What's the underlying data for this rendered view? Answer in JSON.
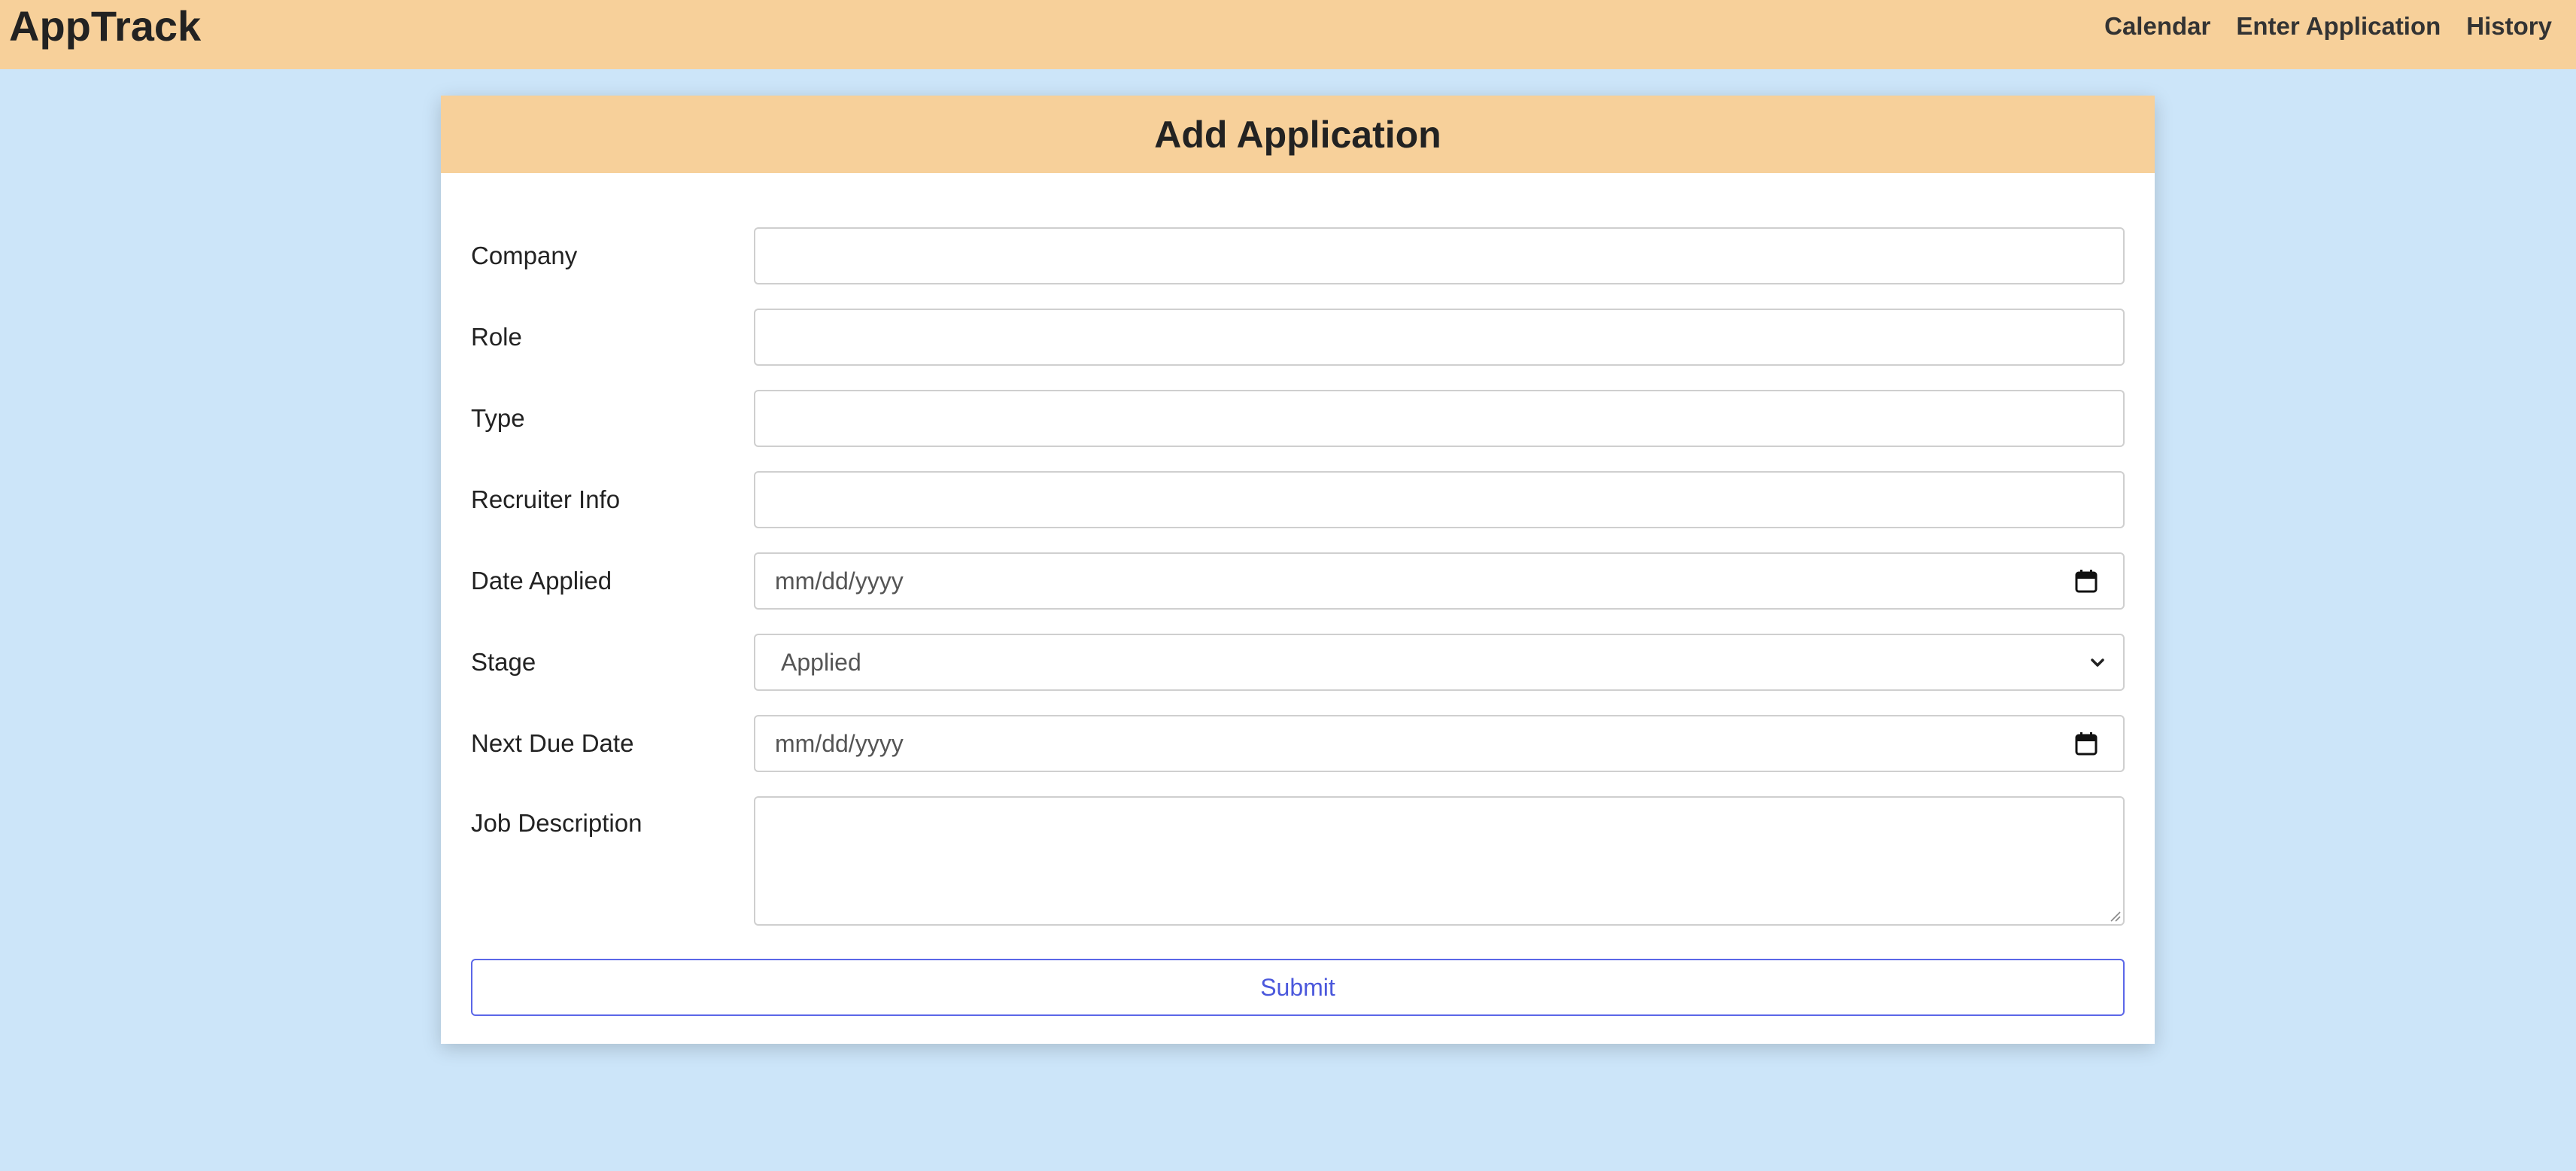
{
  "app": {
    "brand": "AppTrack"
  },
  "nav": {
    "links": [
      "Calendar",
      "Enter Application",
      "History"
    ]
  },
  "form": {
    "title": "Add Application",
    "fields": {
      "company": {
        "label": "Company",
        "value": ""
      },
      "role": {
        "label": "Role",
        "value": ""
      },
      "type": {
        "label": "Type",
        "value": ""
      },
      "recruiter": {
        "label": "Recruiter Info",
        "value": ""
      },
      "date_applied": {
        "label": "Date Applied",
        "placeholder": "mm/dd/yyyy",
        "icon": "calendar-icon"
      },
      "stage": {
        "label": "Stage",
        "selected": "Applied",
        "icon": "chevron-down-icon"
      },
      "next_due": {
        "label": "Next Due Date",
        "placeholder": "mm/dd/yyyy",
        "icon": "calendar-icon"
      },
      "description": {
        "label": "Job Description",
        "value": ""
      }
    },
    "submit_label": "Submit"
  },
  "colors": {
    "page_background": "#cce5f9",
    "header_background": "#f7d09a",
    "submit_accent": "#4b58dc"
  }
}
